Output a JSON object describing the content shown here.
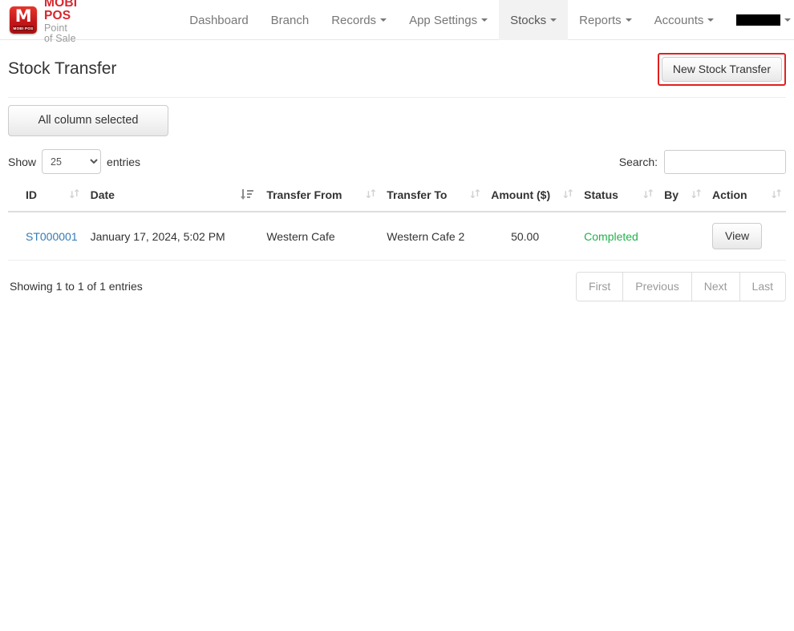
{
  "brand": {
    "logo_mark": "M",
    "logo_badge": "MOBI POS",
    "name": "MOBI POS",
    "tagline": "Point of Sale",
    "logo_color": "#d8262c"
  },
  "nav": {
    "items": [
      {
        "label": "Dashboard",
        "has_caret": false,
        "active": false,
        "redacted": false
      },
      {
        "label": "Branch",
        "has_caret": false,
        "active": false,
        "redacted": false
      },
      {
        "label": "Records",
        "has_caret": true,
        "active": false,
        "redacted": false
      },
      {
        "label": "App Settings",
        "has_caret": true,
        "active": false,
        "redacted": false
      },
      {
        "label": "Stocks",
        "has_caret": true,
        "active": true,
        "redacted": false
      },
      {
        "label": "Reports",
        "has_caret": true,
        "active": false,
        "redacted": false
      },
      {
        "label": "Accounts",
        "has_caret": true,
        "active": false,
        "redacted": false
      },
      {
        "label": "",
        "has_caret": true,
        "active": false,
        "redacted": true
      }
    ]
  },
  "page": {
    "title": "Stock Transfer",
    "new_transfer_label": "New Stock Transfer",
    "new_transfer_highlight_color": "#e02020",
    "column_selector_label": "All column selected"
  },
  "datatable": {
    "length": {
      "prefix": "Show",
      "suffix": "entries",
      "selected": "25",
      "options": [
        "10",
        "25",
        "50",
        "100"
      ]
    },
    "search": {
      "label": "Search:",
      "value": "",
      "placeholder": ""
    },
    "columns": [
      {
        "label": "ID",
        "sort": "none"
      },
      {
        "label": "Date",
        "sort": "desc"
      },
      {
        "label": "Transfer From",
        "sort": "none"
      },
      {
        "label": "Transfer To",
        "sort": "none"
      },
      {
        "label": "Amount ($)",
        "sort": "none"
      },
      {
        "label": "Status",
        "sort": "none"
      },
      {
        "label": "By",
        "sort": "none"
      },
      {
        "label": "Action",
        "sort": "none"
      }
    ],
    "rows": [
      {
        "id": "ST000001",
        "date": "January 17, 2024, 5:02 PM",
        "transfer_from": "Western Cafe",
        "transfer_to": "Western Cafe 2",
        "amount": "50.00",
        "status": "Completed",
        "status_color": "#22b14c",
        "by": "",
        "action_label": "View"
      }
    ],
    "info": "Showing 1 to 1 of 1 entries",
    "pagination": [
      {
        "label": "First",
        "disabled": true
      },
      {
        "label": "Previous",
        "disabled": true
      },
      {
        "label": "Next",
        "disabled": true
      },
      {
        "label": "Last",
        "disabled": true
      }
    ]
  }
}
